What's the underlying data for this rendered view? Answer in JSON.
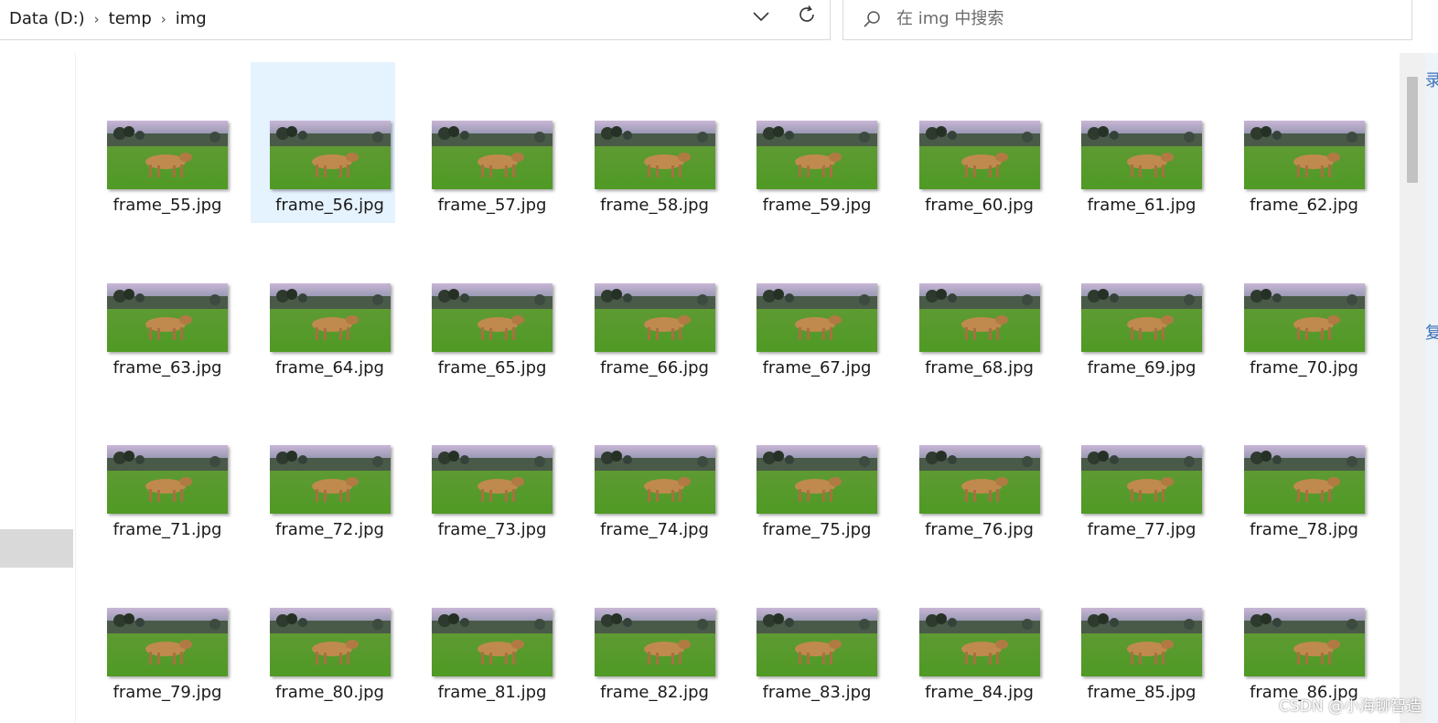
{
  "address_bar": {
    "breadcrumb": [
      "Data (D:)",
      "temp",
      "img"
    ],
    "separator_icon": "chevron-right-icon",
    "dropdown_icon": "chevron-down-icon",
    "refresh_icon": "refresh-icon"
  },
  "search": {
    "placeholder": "在 img 中搜索",
    "icon": "search-icon"
  },
  "files": [
    {
      "name": "frame_55.jpg",
      "selected": false
    },
    {
      "name": "frame_56.jpg",
      "selected": true
    },
    {
      "name": "frame_57.jpg",
      "selected": false
    },
    {
      "name": "frame_58.jpg",
      "selected": false
    },
    {
      "name": "frame_59.jpg",
      "selected": false
    },
    {
      "name": "frame_60.jpg",
      "selected": false
    },
    {
      "name": "frame_61.jpg",
      "selected": false
    },
    {
      "name": "frame_62.jpg",
      "selected": false
    },
    {
      "name": "frame_63.jpg",
      "selected": false
    },
    {
      "name": "frame_64.jpg",
      "selected": false
    },
    {
      "name": "frame_65.jpg",
      "selected": false
    },
    {
      "name": "frame_66.jpg",
      "selected": false
    },
    {
      "name": "frame_67.jpg",
      "selected": false
    },
    {
      "name": "frame_68.jpg",
      "selected": false
    },
    {
      "name": "frame_69.jpg",
      "selected": false
    },
    {
      "name": "frame_70.jpg",
      "selected": false
    },
    {
      "name": "frame_71.jpg",
      "selected": false
    },
    {
      "name": "frame_72.jpg",
      "selected": false
    },
    {
      "name": "frame_73.jpg",
      "selected": false
    },
    {
      "name": "frame_74.jpg",
      "selected": false
    },
    {
      "name": "frame_75.jpg",
      "selected": false
    },
    {
      "name": "frame_76.jpg",
      "selected": false
    },
    {
      "name": "frame_77.jpg",
      "selected": false
    },
    {
      "name": "frame_78.jpg",
      "selected": false
    },
    {
      "name": "frame_79.jpg",
      "selected": false
    },
    {
      "name": "frame_80.jpg",
      "selected": false
    },
    {
      "name": "frame_81.jpg",
      "selected": false
    },
    {
      "name": "frame_82.jpg",
      "selected": false
    },
    {
      "name": "frame_83.jpg",
      "selected": false
    },
    {
      "name": "frame_84.jpg",
      "selected": false
    },
    {
      "name": "frame_85.jpg",
      "selected": false
    },
    {
      "name": "frame_86.jpg",
      "selected": false
    }
  ],
  "right_sliver_chars": [
    "录",
    "复"
  ],
  "watermark": "CSDN @小海聊智造",
  "colors": {
    "selection": "#e5f3ff",
    "nav_selected": "#d9d9d9",
    "scroll_thumb": "#c2c2c2",
    "thumb_sky": "#c9b6d6",
    "thumb_grass": "#4f9a24",
    "thumb_lion": "#c08a4e"
  }
}
